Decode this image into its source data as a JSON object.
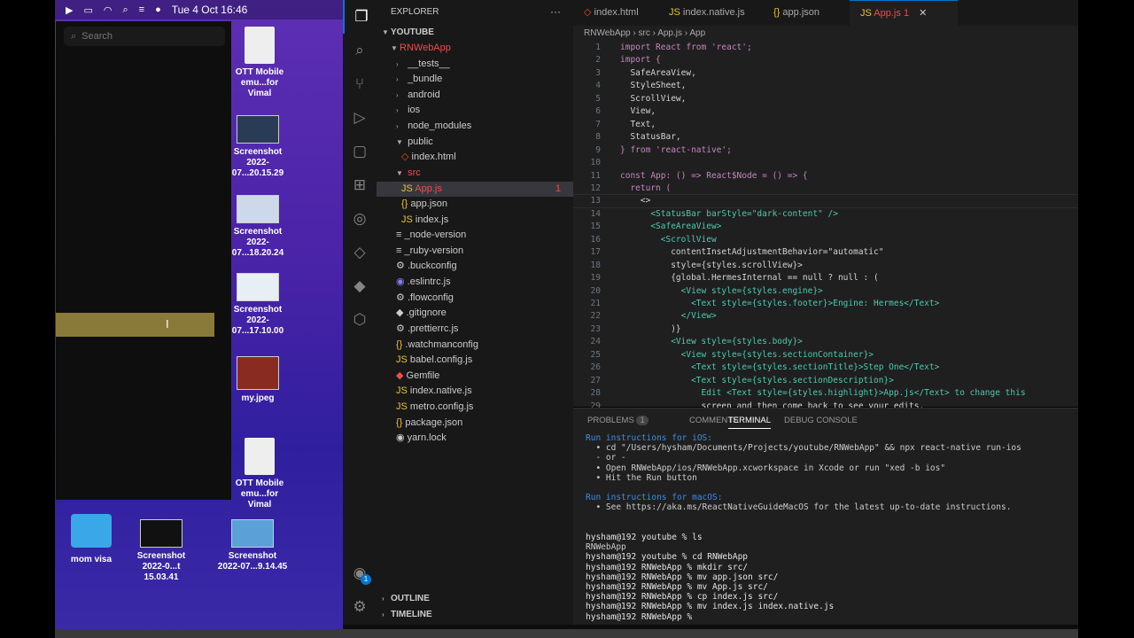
{
  "menubar": {
    "datetime": "Tue 4 Oct  16:46"
  },
  "spotlight": {
    "placeholder": "Search"
  },
  "desktop_icons": [
    {
      "label": "OTT Mobile\nemu...for Vimal"
    },
    {
      "label": "Screenshot\n2022-07...20.15.29"
    },
    {
      "label": "Screenshot\n2022-07...18.20.24"
    },
    {
      "label": "Screenshot\n2022-07...17.10.00"
    },
    {
      "label": "my.jpeg"
    },
    {
      "label": "OTT Mobile\nemu...for Vimal"
    },
    {
      "label": "mom visa"
    },
    {
      "label": "Screenshot\n2022-0...t 15.03.41"
    },
    {
      "label": "Screenshot\n2022-07...9.14.45"
    }
  ],
  "explorer": {
    "title": "EXPLORER",
    "section": "YOUTUBE",
    "root": "RNWebApp",
    "items": [
      "__tests__",
      "_bundle",
      "android",
      "ios",
      "node_modules",
      "public",
      "index.html",
      "src",
      "App.js",
      "app.json",
      "index.js",
      "_node-version",
      "_ruby-version",
      ".buckconfig",
      ".eslintrc.js",
      ".flowconfig",
      ".gitignore",
      ".prettierrc.js",
      ".watchmanconfig",
      "babel.config.js",
      "Gemfile",
      "index.native.js",
      "metro.config.js",
      "package.json",
      "yarn.lock"
    ],
    "app_badge": "1",
    "outline": "OUTLINE",
    "timeline": "TIMELINE"
  },
  "tabs": [
    "index.html",
    "index.native.js",
    "app.json",
    "App.js"
  ],
  "active_tab_badge": "1",
  "breadcrumb": [
    "RNWebApp",
    "src",
    "App.js",
    "App"
  ],
  "code_lines": [
    "import React from 'react';",
    "import {",
    "  SafeAreaView,",
    "  StyleSheet,",
    "  ScrollView,",
    "  View,",
    "  Text,",
    "  StatusBar,",
    "} from 'react-native';",
    "",
    "const App: () => React$Node = () => {",
    "  return (",
    "    <>",
    "      <StatusBar barStyle=\"dark-content\" />",
    "      <SafeAreaView>",
    "        <ScrollView",
    "          contentInsetAdjustmentBehavior=\"automatic\"",
    "          style={styles.scrollView}>",
    "          {global.HermesInternal == null ? null : (",
    "            <View style={styles.engine}>",
    "              <Text style={styles.footer}>Engine: Hermes</Text>",
    "            </View>",
    "          )}",
    "          <View style={styles.body}>",
    "            <View style={styles.sectionContainer}>",
    "              <Text style={styles.sectionTitle}>Step One</Text>",
    "              <Text style={styles.sectionDescription}>",
    "                Edit <Text style={styles.highlight}>App.js</Text> to change this",
    "                screen and then come back to see your edits."
  ],
  "panel_tabs": {
    "problems": "PROBLEMS",
    "problems_count": "1",
    "comments": "COMMENTS",
    "terminal": "TERMINAL",
    "debug": "DEBUG CONSOLE"
  },
  "terminal_lines": [
    "Run instructions for iOS:",
    "  • cd \"/Users/hysham/Documents/Projects/youtube/RNWebApp\" && npx react-native run-ios",
    "  - or -",
    "  • Open RNWebApp/ios/RNWebApp.xcworkspace in Xcode or run \"xed -b ios\"",
    "  • Hit the Run button",
    "",
    "Run instructions for macOS:",
    "  • See https://aka.ms/ReactNativeGuideMacOS for the latest up-to-date instructions.",
    "",
    "",
    "hysham@192 youtube % ls",
    "RNWebApp",
    "hysham@192 youtube % cd RNWebApp",
    "hysham@192 RNWebApp % mkdir src/",
    "hysham@192 RNWebApp % mv app.json src/",
    "hysham@192 RNWebApp % mv App.js src/",
    "hysham@192 RNWebApp % cp index.js src/",
    "hysham@192 RNWebApp % mv index.js index.native.js",
    "hysham@192 RNWebApp % "
  ],
  "accounts_badge": "1",
  "colors": {
    "accent": "#0078d4",
    "desktop_purple": "#4a23a8",
    "error_red": "#f14c4c"
  }
}
